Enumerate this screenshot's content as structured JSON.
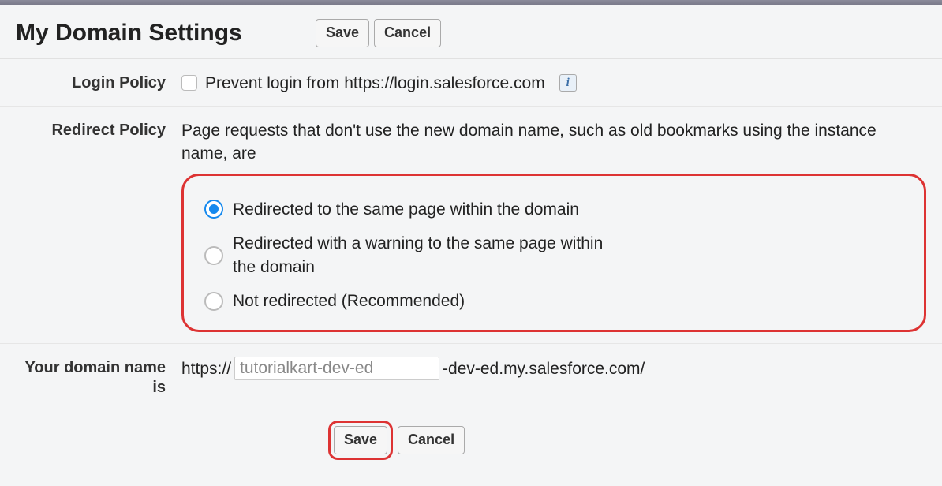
{
  "header": {
    "title": "My Domain Settings",
    "save_label": "Save",
    "cancel_label": "Cancel"
  },
  "login_policy": {
    "label": "Login Policy",
    "checkbox_label": "Prevent login from https://login.salesforce.com",
    "checked": false,
    "info_glyph": "i"
  },
  "redirect_policy": {
    "label": "Redirect Policy",
    "description": "Page requests that don't use the new domain name, such as old bookmarks using the instance name, are",
    "options": [
      {
        "label": "Redirected to the same page within the domain",
        "selected": true
      },
      {
        "label": "Redirected with a warning to the same page within the domain",
        "selected": false
      },
      {
        "label": "Not redirected (Recommended)",
        "selected": false
      }
    ]
  },
  "domain_name": {
    "label": "Your domain name is",
    "prefix": "https://",
    "value": "tutorialkart-dev-ed",
    "suffix": "-dev-ed.my.salesforce.com/"
  },
  "footer": {
    "save_label": "Save",
    "cancel_label": "Cancel"
  }
}
